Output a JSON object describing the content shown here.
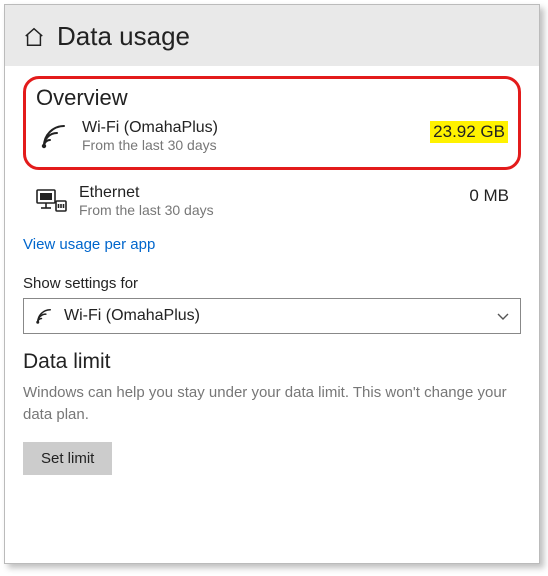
{
  "header": {
    "title": "Data usage"
  },
  "overview": {
    "title": "Overview",
    "items": [
      {
        "name": "Wi-Fi (OmahaPlus)",
        "sub": "From the last 30 days",
        "amount": "23.92 GB"
      },
      {
        "name": "Ethernet",
        "sub": "From the last 30 days",
        "amount": "0 MB"
      }
    ],
    "link": "View usage per app"
  },
  "settingsFor": {
    "label": "Show settings for",
    "selected": "Wi-Fi (OmahaPlus)"
  },
  "dataLimit": {
    "title": "Data limit",
    "description": "Windows can help you stay under your data limit. This won't change your data plan.",
    "button": "Set limit"
  }
}
